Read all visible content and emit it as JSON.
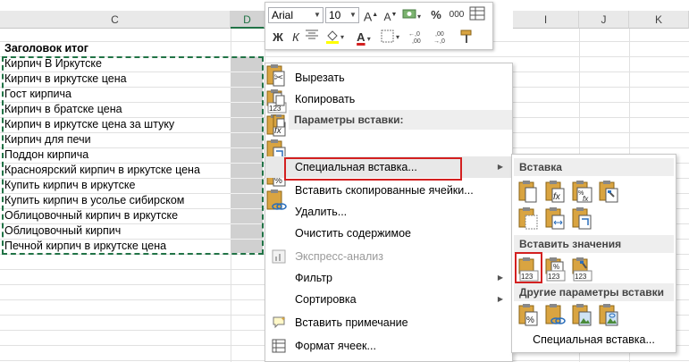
{
  "sheet": {
    "columns": [
      {
        "id": "C",
        "label": "C",
        "selected": false
      },
      {
        "id": "D",
        "label": "D",
        "selected": true
      },
      {
        "id": "I",
        "label": "I",
        "selected": false
      },
      {
        "id": "J",
        "label": "J",
        "selected": false
      },
      {
        "id": "K",
        "label": "K",
        "selected": false
      }
    ],
    "header_cell": "Заголовок итог",
    "rows": [
      "Кирпич В Иркутске",
      "Кирпич в иркутске цена",
      "Гост кирпича",
      "Кирпич в братске цена",
      "Кирпич в иркутске цена за штуку",
      "Кирпич для печи",
      "Поддон кирпича",
      "Красноярский кирпич в иркутске цена",
      "Купить кирпич в иркутске",
      "Купить кирпич в усолье сибирском",
      "Облицовочный кирпич в иркутске",
      "Облицовочный кирпич",
      "Печной кирпич в иркутске цена"
    ]
  },
  "mini_toolbar": {
    "font_name": "Arial",
    "font_size": "10",
    "grow_font": "A",
    "shrink_font": "A",
    "percent": "%",
    "thousands": "000",
    "bold": "Ж",
    "italic": "К",
    "font_color_letter": "A",
    "inc_decimal": "←,0 ,00",
    "dec_decimal": ",00 →,0"
  },
  "context_menu": {
    "cut": "Вырезать",
    "copy": "Копировать",
    "paste_options_header": "Параметры вставки:",
    "paste_special": "Специальная вставка...",
    "insert_copied": "Вставить скопированные ячейки...",
    "delete": "Удалить...",
    "clear": "Очистить содержимое",
    "quick_analysis": "Экспресс-анализ",
    "filter": "Фильтр",
    "sort": "Сортировка",
    "insert_comment": "Вставить примечание",
    "format_cells": "Формат ячеек...",
    "icon_badge_123": "123",
    "icon_fx": "fx",
    "icon_percent": "%"
  },
  "submenu": {
    "paste_header": "Вставка",
    "paste_values_header": "Вставить значения",
    "other_header": "Другие параметры вставки",
    "footer": "Специальная вставка...",
    "badge_123": "123",
    "percent": "%",
    "fx": "fx"
  },
  "colors": {
    "excel_green": "#217346",
    "highlight_red": "#d32020",
    "font_color_red": "#d32020",
    "fill_yellow": "#ffff00"
  }
}
